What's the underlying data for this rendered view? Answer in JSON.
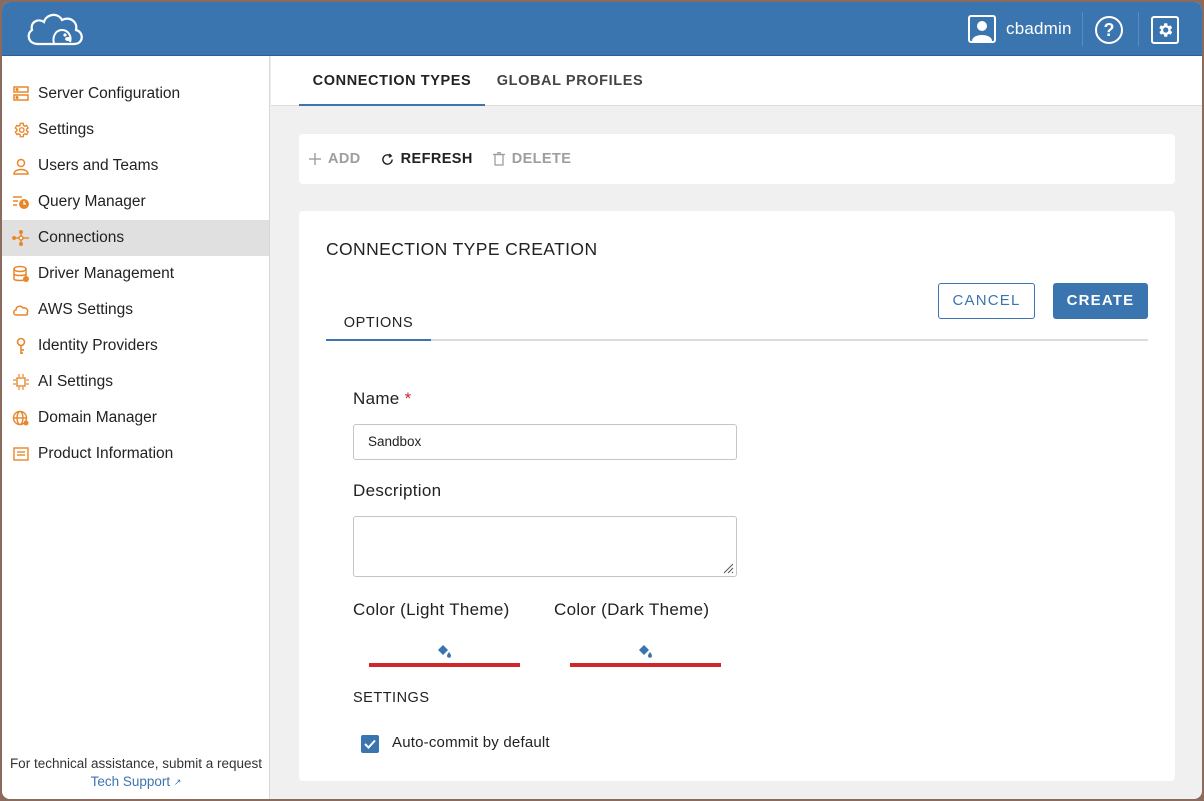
{
  "header": {
    "user_name": "cbadmin",
    "help_icon": "question-circle-icon",
    "settings_icon": "gear-icon",
    "brand_color": "#3b75b0"
  },
  "sidebar": {
    "items": [
      {
        "label": "Server Configuration",
        "icon": "server-config-icon"
      },
      {
        "label": "Settings",
        "icon": "gear-icon"
      },
      {
        "label": "Users and Teams",
        "icon": "user-icon"
      },
      {
        "label": "Query Manager",
        "icon": "query-manager-icon"
      },
      {
        "label": "Connections",
        "icon": "connections-icon",
        "active": true
      },
      {
        "label": "Driver Management",
        "icon": "database-icon"
      },
      {
        "label": "AWS Settings",
        "icon": "cloud-icon"
      },
      {
        "label": "Identity Providers",
        "icon": "key-icon"
      },
      {
        "label": "AI Settings",
        "icon": "chip-icon"
      },
      {
        "label": "Domain Manager",
        "icon": "globe-icon"
      },
      {
        "label": "Product Information",
        "icon": "info-list-icon"
      }
    ],
    "footer_text": "For technical assistance, submit a request",
    "footer_link": "Tech Support"
  },
  "tabs": [
    {
      "label": "CONNECTION TYPES",
      "active": true
    },
    {
      "label": "GLOBAL PROFILES",
      "active": false
    }
  ],
  "toolbar": {
    "add_label": "ADD",
    "refresh_label": "REFRESH",
    "delete_label": "DELETE"
  },
  "form": {
    "title": "CONNECTION TYPE CREATION",
    "cancel_label": "CANCEL",
    "create_label": "CREATE",
    "subtab_label": "OPTIONS",
    "name_label": "Name",
    "required_mark": "*",
    "name_value": "Sandbox",
    "description_label": "Description",
    "description_value": "",
    "color_light_label": "Color (Light Theme)",
    "color_dark_label": "Color (Dark Theme)",
    "color_light_value": "#d0282a",
    "color_dark_value": "#d0282a",
    "settings_label": "SETTINGS",
    "autocommit_label": "Auto-commit by default",
    "autocommit_checked": true
  }
}
